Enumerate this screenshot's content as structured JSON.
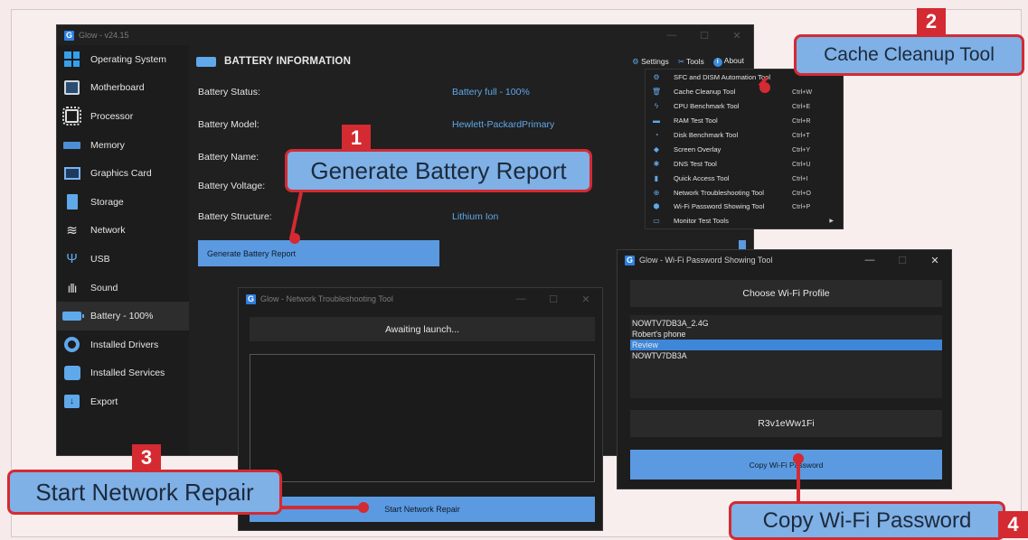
{
  "main_window": {
    "title": "Glow - v24.15",
    "sidebar": [
      {
        "label": "Operating System",
        "icon": "windows-icon"
      },
      {
        "label": "Motherboard",
        "icon": "motherboard-icon"
      },
      {
        "label": "Processor",
        "icon": "processor-icon"
      },
      {
        "label": "Memory",
        "icon": "memory-icon"
      },
      {
        "label": "Graphics Card",
        "icon": "graphics-card-icon"
      },
      {
        "label": "Storage",
        "icon": "storage-icon"
      },
      {
        "label": "Network",
        "icon": "wifi-icon"
      },
      {
        "label": "USB",
        "icon": "usb-icon"
      },
      {
        "label": "Sound",
        "icon": "sound-icon"
      },
      {
        "label": "Battery - 100%",
        "icon": "battery-icon",
        "active": true
      },
      {
        "label": "Installed Drivers",
        "icon": "drivers-icon"
      },
      {
        "label": "Installed Services",
        "icon": "services-icon"
      },
      {
        "label": "Export",
        "icon": "export-icon"
      }
    ],
    "heading": "BATTERY INFORMATION",
    "top_links": {
      "settings": "Settings",
      "tools": "Tools",
      "about": "About"
    },
    "info": [
      {
        "label": "Battery Status:",
        "value": "Battery full - 100%"
      },
      {
        "label": "Battery Model:",
        "value": "Hewlett-PackardPrimary"
      },
      {
        "label": "Battery Name:",
        "value": ""
      },
      {
        "label": "Battery Voltage:",
        "value": ""
      },
      {
        "label": "Battery Structure:",
        "value": "Lithium Ion"
      }
    ],
    "generate_button": "Generate Battery Report"
  },
  "tools_menu": [
    {
      "label": "SFC and DISM Automation Tool",
      "shortcut": ""
    },
    {
      "label": "Cache Cleanup Tool",
      "shortcut": "Ctrl+W"
    },
    {
      "label": "CPU Benchmark Tool",
      "shortcut": "Ctrl+E"
    },
    {
      "label": "RAM Test Tool",
      "shortcut": "Ctrl+R"
    },
    {
      "label": "Disk Benchmark Tool",
      "shortcut": "Ctrl+T"
    },
    {
      "label": "Screen Overlay",
      "shortcut": "Ctrl+Y"
    },
    {
      "label": "DNS Test Tool",
      "shortcut": "Ctrl+U"
    },
    {
      "label": "Quick Access Tool",
      "shortcut": "Ctrl+I"
    },
    {
      "label": "Network Troubleshooting Tool",
      "shortcut": "Ctrl+O"
    },
    {
      "label": "Wi-Fi Password Showing Tool",
      "shortcut": "Ctrl+P"
    },
    {
      "label": "Monitor Test Tools",
      "shortcut": "",
      "submenu": true
    }
  ],
  "network_window": {
    "title": "Glow - Network Troubleshooting Tool",
    "status": "Awaiting launch...",
    "button": "Start Network Repair"
  },
  "wifi_window": {
    "title": "Glow - Wi-Fi Password Showing Tool",
    "choose_label": "Choose Wi-Fi Profile",
    "profiles": [
      "NOWTV7DB3A_2.4G",
      "Robert's phone",
      "Review",
      "NOWTV7DB3A"
    ],
    "selected_profile": "Review",
    "password": "R3v1eWw1Fi",
    "button": "Copy Wi-Fi Password"
  },
  "callouts": {
    "c1": {
      "number": "1",
      "text": "Generate Battery Report"
    },
    "c2": {
      "number": "2",
      "text": "Cache Cleanup Tool"
    },
    "c3": {
      "number": "3",
      "text": "Start Network Repair"
    },
    "c4": {
      "number": "4",
      "text": "Copy Wi-Fi Password"
    }
  },
  "colors": {
    "accent": "#5b9ae0",
    "callout_red": "#d42a32",
    "callout_fill": "#7fb0e6",
    "window_bg": "#202020"
  }
}
